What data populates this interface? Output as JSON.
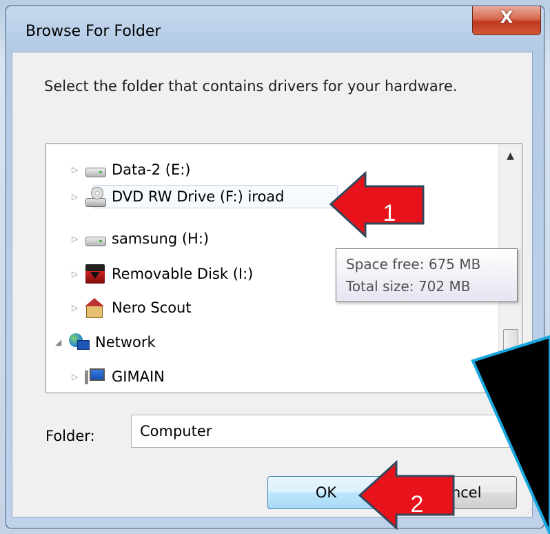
{
  "dialog": {
    "title": "Browse For Folder",
    "close_label": "X",
    "instruction": "Select the folder that contains drivers for your hardware."
  },
  "tree": {
    "items": [
      {
        "label": "Data-2 (E:)",
        "icon": "hard-drive-icon",
        "expander": "collapsed"
      },
      {
        "label": "DVD RW Drive (F:) iroad",
        "icon": "dvd-drive-icon",
        "expander": "collapsed"
      },
      {
        "label": "samsung (H:)",
        "icon": "hard-drive-icon",
        "expander": "collapsed"
      },
      {
        "label": "Removable Disk (I:)",
        "icon": "removable-disk-icon",
        "expander": "collapsed"
      },
      {
        "label": "Nero Scout",
        "icon": "nero-scout-icon",
        "expander": "collapsed"
      },
      {
        "label": "Network",
        "icon": "network-icon",
        "expander": "expanded"
      },
      {
        "label": "GIMAIN",
        "icon": "computer-icon",
        "expander": "collapsed"
      }
    ],
    "scroll_up_glyph": "▲",
    "expander_collapsed_glyph": "▷",
    "expander_expanded_glyph": "◢"
  },
  "tooltip": {
    "space_free": "Space free: 675 MB",
    "total_size": "Total size: 702 MB"
  },
  "folder": {
    "label": "Folder:",
    "value": "Computer"
  },
  "buttons": {
    "ok": "OK",
    "cancel": "Cancel"
  },
  "annotations": {
    "arrow1": "1",
    "arrow2": "2",
    "arrow_color": "#e8121b"
  }
}
